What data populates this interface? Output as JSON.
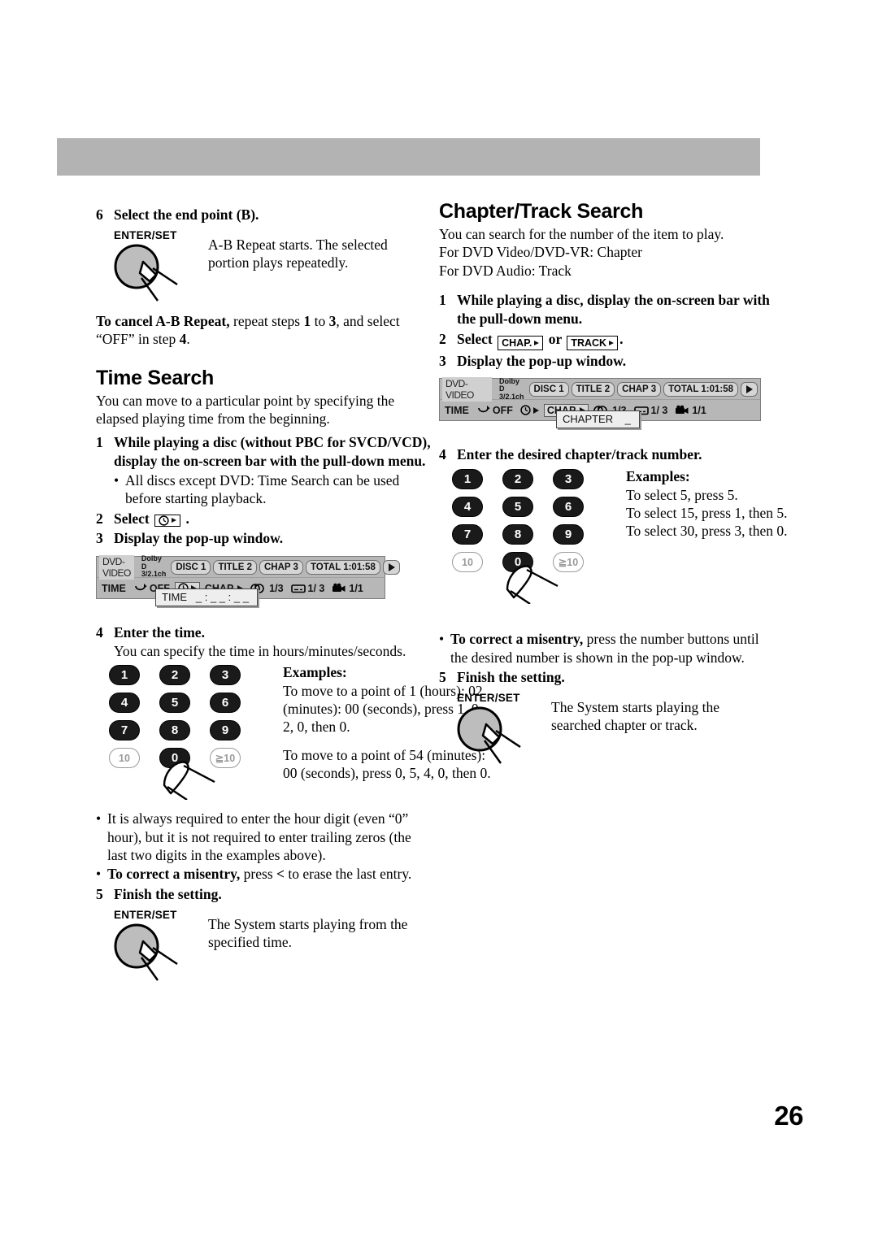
{
  "page": {
    "number": "26"
  },
  "left_column": {
    "step6": {
      "num": "6",
      "title": "Select the end point (B).",
      "knob_label": "ENTER/SET",
      "knob_text": "A-B Repeat starts. The selected portion plays repeatedly."
    },
    "cancel_note": {
      "bold": "To cancel A-B Repeat,",
      "rest_1": " repeat steps ",
      "num_1": "1",
      "rest_2": " to ",
      "num_3": "3",
      "rest_3": ", and select “OFF” in step ",
      "num_4": "4",
      "rest_4": "."
    },
    "section": {
      "title": "Time Search",
      "intro": "You can move to a particular point by specifying the elapsed playing time from the beginning.",
      "steps": [
        {
          "num": "1",
          "text": "While playing a disc (without PBC for SVCD/VCD), display the on-screen bar with the pull-down menu."
        },
        {
          "num": "2",
          "text_before": "Select",
          "text_after": "."
        },
        {
          "num": "3",
          "text": "Display the pop-up window."
        },
        {
          "num": "4",
          "text": "Enter the time.",
          "sub": "You can specify the time in hours/minutes/seconds."
        },
        {
          "num": "5",
          "text": "Finish the setting."
        }
      ],
      "step1_bullet": "All discs except DVD: Time Search can be used before starting playback.",
      "select_icon_label": "clock-arrow-icon",
      "examples": {
        "heading": "Examples:",
        "line1": "To move to a point of 1 (hours): 02 (minutes): 00 (seconds), press 1, 0, 2, 0, then 0.",
        "line2": "To move to a point of 54 (minutes): 00 (seconds), press 0, 5, 4, 0, then 0."
      },
      "notes": [
        "It is always required to enter the hour digit (even “0” hour), but it is not required to enter trailing zeros (the last two digits in the examples above)."
      ],
      "misentry": {
        "bold": "To correct a misentry,",
        "rest_a": " press ",
        "key": "<",
        "rest_b": " to erase the last entry."
      },
      "finish_knob_label": "ENTER/SET",
      "finish_knob_text": "The System starts playing from the specified time."
    },
    "osd": {
      "disc_type": "DVD-VIDEO",
      "audio_format_line1": "Dolby D",
      "audio_format_line2": "3/2.1ch",
      "chips": [
        "DISC 1",
        "TITLE 2",
        "CHAP 3",
        "TOTAL   1:01:58"
      ],
      "row2": {
        "time_label": "TIME",
        "repeat_value": "OFF",
        "chapter_label": "CHAP.",
        "audio_value": "1/3",
        "subtitle_value": "1/ 3",
        "angle_value": "1/1"
      },
      "popup": "TIME   _ : _ _ : _ _",
      "selected_cell": "time-search-cell"
    }
  },
  "right_column": {
    "section": {
      "title": "Chapter/Track Search",
      "intro_line1": "You can search for the number of the item to play.",
      "intro_line2": "For DVD Video/DVD-VR: Chapter",
      "intro_line3": "For DVD Audio: Track",
      "steps": [
        {
          "num": "1",
          "text": "While playing a disc, display the on-screen bar with the pull-down menu."
        },
        {
          "num": "2",
          "text_before": "Select",
          "text_or": "or",
          "text_after": "."
        },
        {
          "num": "3",
          "text": "Display the pop-up window."
        },
        {
          "num": "4",
          "text": "Enter the desired chapter/track number."
        },
        {
          "num": "5",
          "text": "Finish the setting."
        }
      ],
      "chap_button": "CHAP.",
      "track_button": "TRACK",
      "examples": {
        "heading": "Examples:",
        "line1": "To select 5, press 5.",
        "line2": "To select 15, press 1, then 5.",
        "line3": "To select 30, press 3, then 0."
      },
      "misentry": {
        "bold": "To correct a misentry,",
        "rest": " press the number buttons until the desired number is shown in the pop-up window."
      },
      "finish_knob_label": "ENTER/SET",
      "finish_knob_text": "The System starts playing the searched chapter or track."
    },
    "osd": {
      "disc_type": "DVD-VIDEO",
      "audio_format_line1": "Dolby D",
      "audio_format_line2": "3/2.1ch",
      "chips": [
        "DISC 1",
        "TITLE 2",
        "CHAP 3",
        "TOTAL   1:01:58"
      ],
      "row2": {
        "time_label": "TIME",
        "repeat_value": "OFF",
        "chapter_label": "CHAP.",
        "audio_value": "1/3",
        "subtitle_value": "1/ 3",
        "angle_value": "1/1"
      },
      "popup": "CHAPTER    _",
      "selected_cell": "chapter-search-cell"
    }
  },
  "keypad": {
    "rows": [
      [
        "1",
        "2",
        "3"
      ],
      [
        "4",
        "5",
        "6"
      ],
      [
        "7",
        "8",
        "9"
      ],
      [
        "10",
        "0",
        "≧10"
      ]
    ]
  },
  "colors": {
    "header_bar": "#b3b3b3",
    "osd_background": "#b7b7b7",
    "key_fill": "#1a1a1a",
    "key_grey": "#9a9a9a"
  }
}
